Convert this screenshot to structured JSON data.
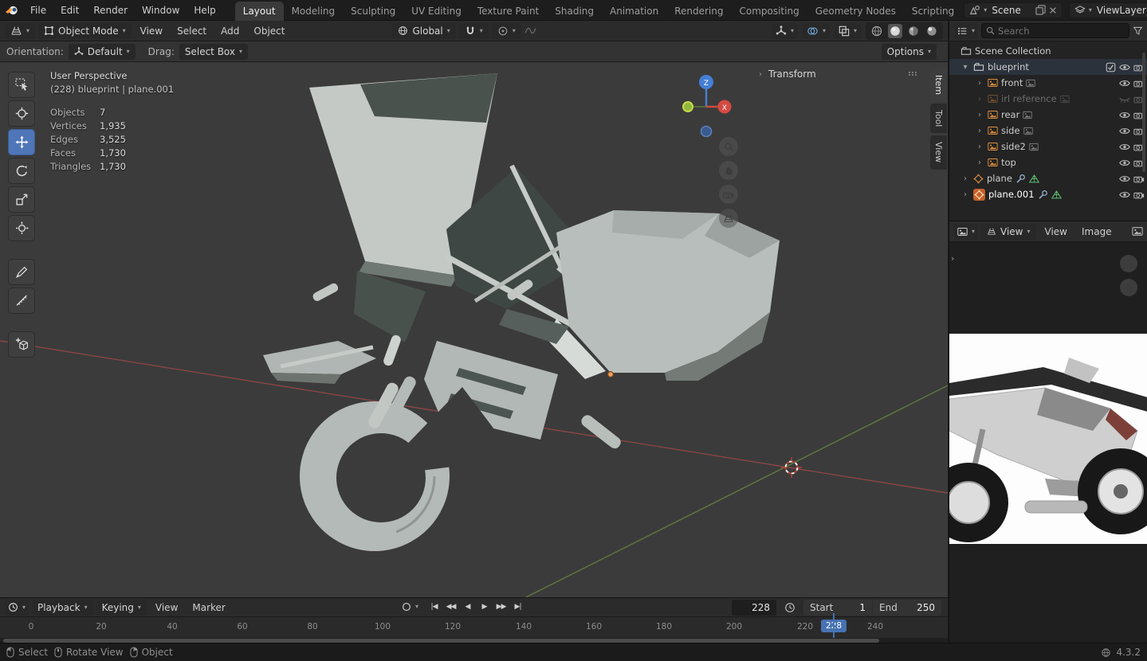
{
  "icons": {
    "caret": "▾",
    "chevron_right": "›",
    "chevron_down": "▾",
    "transport": {
      "jump_start": "|◀",
      "prev_key": "◀◀",
      "play_rev": "◀",
      "play": "▶",
      "next_key": "▶▶",
      "jump_end": "▶|"
    }
  },
  "topbar": {
    "menus": [
      "File",
      "Edit",
      "Render",
      "Window",
      "Help"
    ],
    "workspaces": [
      "Layout",
      "Modeling",
      "Sculpting",
      "UV Editing",
      "Texture Paint",
      "Shading",
      "Animation",
      "Rendering",
      "Compositing",
      "Geometry Nodes",
      "Scripting"
    ],
    "scene_name": "Scene",
    "viewlayer_name": "ViewLayer"
  },
  "viewport_header": {
    "mode": "Object Mode",
    "menus": [
      "View",
      "Select",
      "Add",
      "Object"
    ],
    "orientation": "Global"
  },
  "tool_settings": {
    "orientation_label": "Orientation:",
    "orientation_value": "Default",
    "drag_label": "Drag:",
    "drag_value": "Select Box",
    "options_label": "Options"
  },
  "viewport": {
    "view_label": "User Perspective",
    "context_label": "(228) blueprint | plane.001",
    "stats": {
      "rows": [
        {
          "label": "Objects",
          "value": "7"
        },
        {
          "label": "Vertices",
          "value": "1,935"
        },
        {
          "label": "Edges",
          "value": "3,525"
        },
        {
          "label": "Faces",
          "value": "1,730"
        },
        {
          "label": "Triangles",
          "value": "1,730"
        }
      ]
    },
    "transform_panel_label": "Transform",
    "side_tabs": [
      "Item",
      "Tool",
      "View"
    ],
    "gizmo": {
      "z": "Z",
      "x": "X"
    }
  },
  "outliner": {
    "search_placeholder": "Search",
    "scene_collection_label": "Scene Collection",
    "rows": [
      {
        "label": "blueprint"
      },
      {
        "label": "front"
      },
      {
        "label": "irl reference"
      },
      {
        "label": "rear"
      },
      {
        "label": "side"
      },
      {
        "label": "side2"
      },
      {
        "label": "top"
      },
      {
        "label": "plane"
      },
      {
        "label": "plane.001"
      }
    ]
  },
  "image_editor": {
    "mode": "View",
    "menus": [
      "View",
      "Image"
    ]
  },
  "timeline": {
    "playback_label": "Playback",
    "keying_label": "Keying",
    "menus": [
      "View",
      "Marker"
    ],
    "current_frame": "228",
    "playhead_frame": "228",
    "start_label": "Start",
    "start_value": "1",
    "end_label": "End",
    "end_value": "250",
    "ticks": [
      "0",
      "20",
      "40",
      "60",
      "80",
      "100",
      "120",
      "140",
      "160",
      "180",
      "200",
      "220",
      "240"
    ]
  },
  "statusbar": {
    "items": [
      "Select",
      "Rotate View",
      "Object"
    ],
    "version": "4.3.2"
  }
}
